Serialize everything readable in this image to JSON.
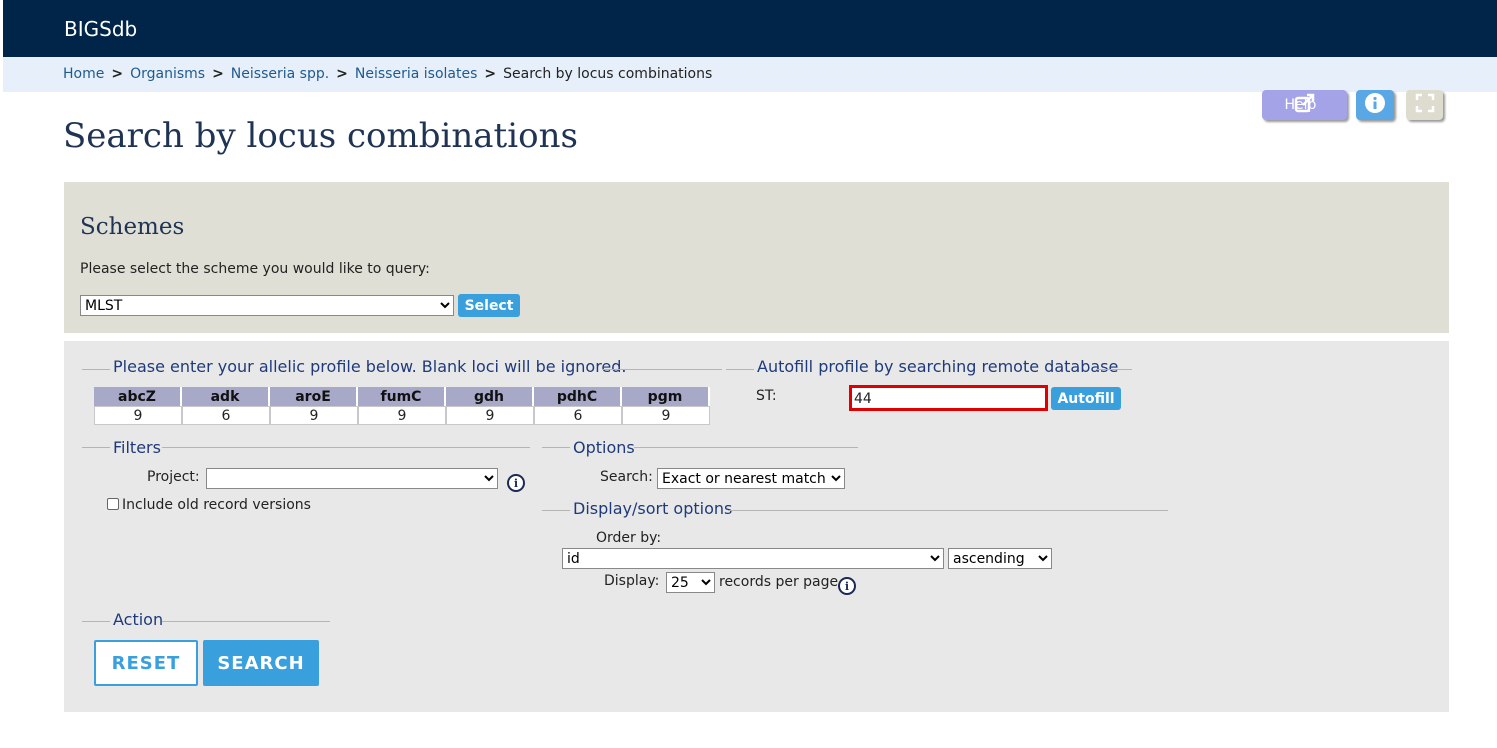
{
  "app": {
    "brand": "BIGSdb"
  },
  "breadcrumb": {
    "items": [
      "Home",
      "Organisms",
      "Neisseria spp.",
      "Neisseria isolates"
    ],
    "current": "Search by locus combinations",
    "separator": ">"
  },
  "toolbar": {
    "help_label": "Help"
  },
  "page": {
    "title": "Search by locus combinations"
  },
  "schemes": {
    "heading": "Schemes",
    "prompt": "Please select the scheme you would like to query:",
    "selected": "MLST",
    "select_button": "Select"
  },
  "profile": {
    "legend": "Please enter your allelic profile below. Blank loci will be ignored.",
    "loci": [
      "abcZ",
      "adk",
      "aroE",
      "fumC",
      "gdh",
      "pdhC",
      "pgm"
    ],
    "values": [
      "9",
      "6",
      "9",
      "9",
      "9",
      "6",
      "9"
    ]
  },
  "autofill": {
    "legend": "Autofill profile by searching remote database",
    "st_label": "ST:",
    "st_value": "44",
    "button": "Autofill"
  },
  "filters": {
    "legend": "Filters",
    "project_label": "Project:",
    "project_value": "",
    "old_versions_label": "Include old record versions"
  },
  "options": {
    "legend": "Options",
    "search_label": "Search:",
    "search_value": "Exact or nearest match"
  },
  "display": {
    "legend": "Display/sort options",
    "order_label": "Order by:",
    "order_value": "id",
    "direction_value": "ascending",
    "display_label": "Display:",
    "display_value": "25",
    "records_suffix": "records per page"
  },
  "action": {
    "legend": "Action",
    "reset": "RESET",
    "search": "SEARCH"
  },
  "colors": {
    "topbar": "#002548",
    "accent": "#3a9fdd",
    "highlight_border": "#e00000"
  },
  "icons": {
    "external_link": "external-link-icon",
    "info": "info-icon",
    "fullscreen": "fullscreen-icon"
  }
}
